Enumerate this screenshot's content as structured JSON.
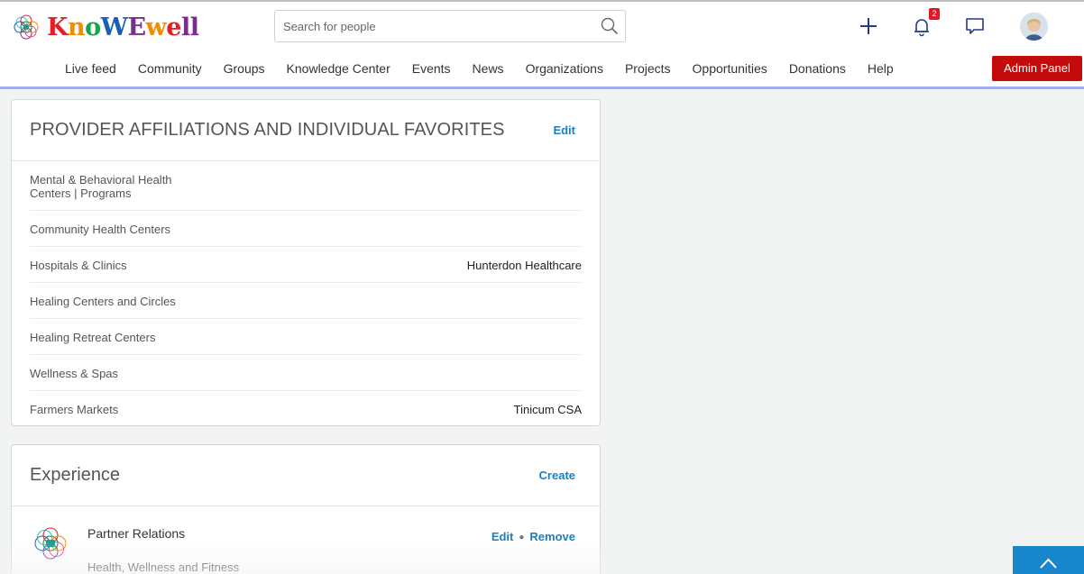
{
  "header": {
    "logo": {
      "letters": [
        "K",
        "n",
        "o",
        "W",
        "E",
        "w",
        "e",
        "l",
        "l"
      ],
      "colors": [
        "#e31e24",
        "#f28c00",
        "#1ba34a",
        "#1a5fb4",
        "#7b2d8e",
        "#f28c00",
        "#e31e24",
        "#7b2d8e",
        "#7b2d8e"
      ]
    },
    "search": {
      "placeholder": "Search for people",
      "value": ""
    },
    "notifications_count": "2",
    "icons": [
      "plus-icon",
      "bell-icon",
      "chat-icon",
      "search-icon"
    ]
  },
  "nav": {
    "items": [
      {
        "label": "Live feed"
      },
      {
        "label": "Community"
      },
      {
        "label": "Groups"
      },
      {
        "label": "Knowledge Center"
      },
      {
        "label": "Events"
      },
      {
        "label": "News"
      },
      {
        "label": "Organizations"
      },
      {
        "label": "Projects"
      },
      {
        "label": "Opportunities"
      },
      {
        "label": "Donations"
      },
      {
        "label": "Help"
      }
    ],
    "admin_label": "Admin Panel"
  },
  "affiliations": {
    "title": "PROVIDER AFFILIATIONS AND INDIVIDUAL FAVORITES",
    "action": "Edit",
    "rows": [
      {
        "label": "Mental & Behavioral Health Centers | Programs",
        "value": ""
      },
      {
        "label": "Community Health Centers",
        "value": ""
      },
      {
        "label": "Hospitals & Clinics",
        "value": "Hunterdon Healthcare"
      },
      {
        "label": "Healing Centers and Circles",
        "value": ""
      },
      {
        "label": "Healing Retreat Centers",
        "value": ""
      },
      {
        "label": "Wellness & Spas",
        "value": ""
      },
      {
        "label": "Farmers Markets",
        "value": "Tinicum CSA"
      }
    ]
  },
  "experience": {
    "title": "Experience",
    "action": "Create",
    "items": [
      {
        "title": "Partner Relations",
        "subtitle": "Health, Wellness and Fitness",
        "edit_label": "Edit",
        "remove_label": "Remove"
      }
    ]
  },
  "colors": {
    "accent": "#1a7fc1",
    "admin": "#c40b0b",
    "nav_border": "#a4acea",
    "badge": "#e4142a"
  }
}
